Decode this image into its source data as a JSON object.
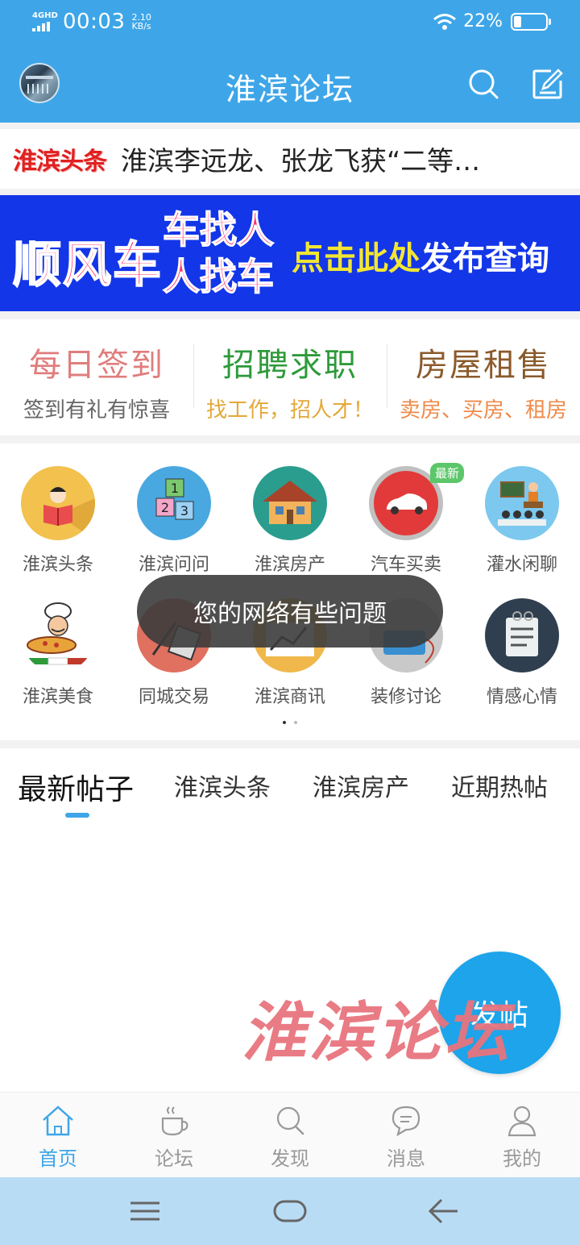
{
  "status_bar": {
    "network": "4GHD",
    "time": "00:03",
    "speed_value": "2.10",
    "speed_unit": "KB/s",
    "battery_percent": "22%",
    "battery_level": 0.22
  },
  "app_bar": {
    "title": "淮滨论坛"
  },
  "headline": {
    "tag": "淮滨头条",
    "text": "淮滨李远龙、张龙飞获“二等…"
  },
  "banner": {
    "text1": "顺风车",
    "text2a": "车找人",
    "text2b": "人找车",
    "text3_highlight": "点击此处",
    "text3_rest": "发布查询"
  },
  "quick_links": [
    {
      "title": "每日签到",
      "subtitle": "签到有礼有惊喜",
      "title_color": "#e07d7d",
      "sub_color": "#666666"
    },
    {
      "title": "招聘求职",
      "subtitle": "找工作，招人才！",
      "title_color": "#2e9a3a",
      "sub_color": "#e4a83a"
    },
    {
      "title": "房屋租售",
      "subtitle": "卖房、买房、租房",
      "title_color": "#8b5a2b",
      "sub_color": "#ee8a4a"
    }
  ],
  "grid": {
    "new_badge": "最新",
    "items": [
      {
        "label": "淮滨头条",
        "icon": "reading-person-icon"
      },
      {
        "label": "淮滨问问",
        "icon": "number-blocks-icon"
      },
      {
        "label": "淮滨房产",
        "icon": "house-icon"
      },
      {
        "label": "汽车买卖",
        "icon": "car-icon"
      },
      {
        "label": "灌水闲聊",
        "icon": "classroom-icon"
      },
      {
        "label": "淮滨美食",
        "icon": "chef-pizza-icon"
      },
      {
        "label": "同城交易",
        "icon": "calculator-icon"
      },
      {
        "label": "淮滨商讯",
        "icon": "chart-board-icon"
      },
      {
        "label": "装修讨论",
        "icon": "toolbox-icon"
      },
      {
        "label": "情感心情",
        "icon": "notepad-icon"
      }
    ]
  },
  "toast": "您的网络有些问题",
  "tabs": [
    "最新帖子",
    "淮滨头条",
    "淮滨房产",
    "近期热帖"
  ],
  "fab_label": "发帖",
  "watermark": "淮滨论坛",
  "bottom_nav": [
    {
      "label": "首页",
      "icon": "home-icon",
      "active": true
    },
    {
      "label": "论坛",
      "icon": "coffee-icon",
      "active": false
    },
    {
      "label": "发现",
      "icon": "search-icon",
      "active": false
    },
    {
      "label": "消息",
      "icon": "message-icon",
      "active": false
    },
    {
      "label": "我的",
      "icon": "user-icon",
      "active": false
    }
  ],
  "colors": {
    "primary": "#3ea6e8",
    "fab": "#1da4ea",
    "banner_bg": "#1336e8"
  }
}
